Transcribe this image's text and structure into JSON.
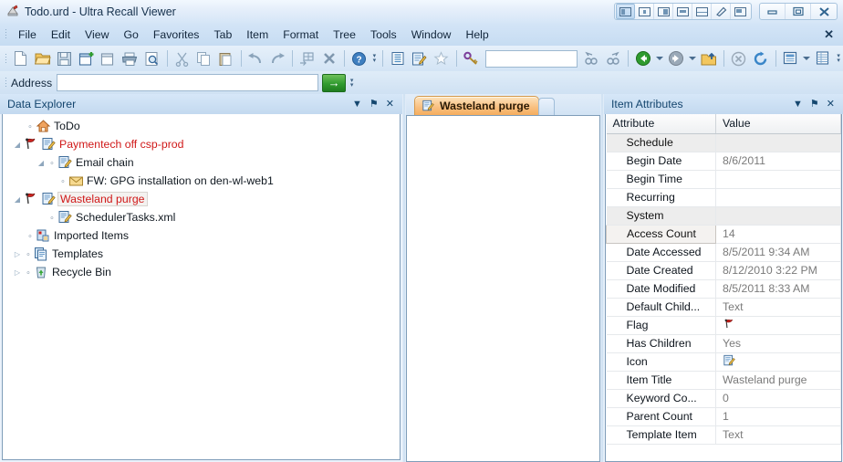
{
  "window": {
    "title": "Todo.urd - Ultra Recall Viewer",
    "icon": "app-icon",
    "layout_buttons": [
      {
        "name": "layout-left-pane",
        "icon": "panel-left-icon"
      },
      {
        "name": "layout-center-pane",
        "icon": "panel-center-icon"
      },
      {
        "name": "layout-right-pane",
        "icon": "panel-right-icon"
      },
      {
        "name": "layout-wide-pane",
        "icon": "panel-wide-icon"
      },
      {
        "name": "layout-split-horizontal",
        "icon": "panel-split-icon"
      },
      {
        "name": "layout-float",
        "icon": "panel-float-icon"
      },
      {
        "name": "layout-tabbed",
        "icon": "panel-tabbed-icon"
      }
    ],
    "controls": [
      {
        "name": "minimize-button",
        "icon": "minimize-icon",
        "glyph": "–"
      },
      {
        "name": "maximize-button",
        "icon": "maximize-icon",
        "glyph": "□"
      },
      {
        "name": "close-button",
        "icon": "close-icon",
        "glyph": "✕"
      }
    ]
  },
  "menubar": {
    "items": [
      "File",
      "Edit",
      "View",
      "Go",
      "Favorites",
      "Tab",
      "Item",
      "Format",
      "Tree",
      "Tools",
      "Window",
      "Help"
    ],
    "close_glyph": "✕"
  },
  "toolbar": {
    "buttons": [
      {
        "name": "new-document-button",
        "icon": "new-document-icon"
      },
      {
        "name": "open-button",
        "icon": "open-folder-icon"
      },
      {
        "name": "save-button",
        "icon": "save-disk-icon"
      },
      {
        "name": "new-item-button",
        "icon": "new-item-icon"
      },
      {
        "name": "new-window-button",
        "icon": "new-window-icon"
      },
      {
        "name": "print-button",
        "icon": "printer-icon"
      },
      {
        "name": "print-preview-button",
        "icon": "print-preview-icon"
      },
      {
        "name": "cut-button",
        "icon": "scissors-icon"
      },
      {
        "name": "copy-button",
        "icon": "copy-icon"
      },
      {
        "name": "paste-button",
        "icon": "paste-icon"
      },
      {
        "name": "undo-button",
        "icon": "undo-arrow-icon"
      },
      {
        "name": "redo-button",
        "icon": "redo-arrow-icon"
      },
      {
        "name": "insert-button",
        "icon": "insert-grid-icon"
      },
      {
        "name": "delete-button",
        "icon": "delete-x-icon"
      },
      {
        "name": "help-button",
        "icon": "help-question-icon"
      },
      {
        "name": "outline-button",
        "icon": "outline-list-icon"
      },
      {
        "name": "edit-item-button",
        "icon": "edit-note-icon"
      },
      {
        "name": "favorites-button",
        "icon": "star-icon"
      },
      {
        "name": "keyword-button",
        "icon": "key-icon"
      },
      {
        "name": "find-previous-button",
        "icon": "find-back-icon"
      },
      {
        "name": "find-next-button",
        "icon": "find-forward-icon"
      },
      {
        "name": "back-button",
        "icon": "back-green-arrow-icon"
      },
      {
        "name": "forward-button",
        "icon": "forward-gray-arrow-icon"
      },
      {
        "name": "up-folder-button",
        "icon": "up-folder-icon"
      },
      {
        "name": "stop-button",
        "icon": "stop-circle-icon"
      },
      {
        "name": "refresh-button",
        "icon": "refresh-icon"
      },
      {
        "name": "view-mode-button",
        "icon": "view-pane-icon"
      },
      {
        "name": "properties-button",
        "icon": "properties-grid-icon"
      }
    ],
    "search": {
      "value": "",
      "placeholder": ""
    },
    "overflow_glyph": "⌵"
  },
  "address": {
    "label": "Address",
    "value": "",
    "placeholder": "",
    "go_glyph": "→",
    "go_title": "Go"
  },
  "left_panel": {
    "title": "Data Explorer",
    "tools": [
      {
        "name": "panel-menu-button",
        "icon": "chevron-down-icon",
        "glyph": "▼"
      },
      {
        "name": "panel-pin-button",
        "icon": "pin-icon",
        "glyph": "⚑"
      },
      {
        "name": "panel-close-button",
        "icon": "close-icon",
        "glyph": "✕"
      }
    ],
    "tree": [
      {
        "label": "ToDo",
        "icon": "home-icon",
        "indent": 0,
        "expander": "",
        "dot": true,
        "style": "normal"
      },
      {
        "label": "Paymentech off csp-prod",
        "icon": "note-edit-icon",
        "indent": 0,
        "expander": "collapse",
        "dot": false,
        "flag": true,
        "style": "red"
      },
      {
        "label": "Email chain",
        "icon": "note-edit-icon",
        "indent": 1,
        "expander": "collapse",
        "dot": true,
        "style": "normal"
      },
      {
        "label": "FW: GPG installation on den-wl-web1",
        "icon": "envelope-icon",
        "indent": 2,
        "expander": "",
        "dot": true,
        "style": "normal"
      },
      {
        "label": "Wasteland purge",
        "icon": "note-edit-icon",
        "indent": 0,
        "expander": "collapse",
        "dot": false,
        "flag": true,
        "style": "selected"
      },
      {
        "label": "SchedulerTasks.xml",
        "icon": "note-edit-icon",
        "indent": 1,
        "expander": "",
        "dot": true,
        "style": "normal"
      },
      {
        "label": "Imported Items",
        "icon": "imported-items-icon",
        "indent": 0,
        "expander": "",
        "dot": true,
        "style": "normal"
      },
      {
        "label": "Templates",
        "icon": "templates-icon",
        "indent": 0,
        "expander": "expand",
        "dot": true,
        "style": "normal"
      },
      {
        "label": "Recycle Bin",
        "icon": "recycle-bin-icon",
        "indent": 0,
        "expander": "expand",
        "dot": true,
        "style": "normal"
      }
    ]
  },
  "center_panel": {
    "tab": {
      "label": "Wasteland purge",
      "icon": "note-edit-icon",
      "active": true
    },
    "content": ""
  },
  "right_panel": {
    "title": "Item Attributes",
    "tools": [
      {
        "name": "panel-menu-button",
        "icon": "chevron-down-icon",
        "glyph": "▼"
      },
      {
        "name": "panel-pin-button",
        "icon": "pin-icon",
        "glyph": "⚑"
      },
      {
        "name": "panel-close-button",
        "icon": "close-icon",
        "glyph": "✕"
      }
    ],
    "columns": [
      "Attribute",
      "Value"
    ],
    "rows": [
      {
        "name": "Schedule",
        "value": "",
        "group": true
      },
      {
        "name": "Begin Date",
        "value": "8/6/2011"
      },
      {
        "name": "Begin Time",
        "value": ""
      },
      {
        "name": "Recurring",
        "value": ""
      },
      {
        "name": "System",
        "value": "",
        "group": true
      },
      {
        "name": "Access Count",
        "value": "14",
        "selected": true
      },
      {
        "name": "Date Accessed",
        "value": "8/5/2011 9:34 AM"
      },
      {
        "name": "Date Created",
        "value": "8/12/2010 3:22 PM"
      },
      {
        "name": "Date Modified",
        "value": "8/5/2011 8:33 AM"
      },
      {
        "name": "Default Child...",
        "value": "Text"
      },
      {
        "name": "Flag",
        "value": "",
        "icon": "red-flag-icon"
      },
      {
        "name": "Has Children",
        "value": "Yes"
      },
      {
        "name": "Icon",
        "value": "",
        "icon": "note-edit-icon"
      },
      {
        "name": "Item Title",
        "value": "Wasteland purge"
      },
      {
        "name": "Keyword Co...",
        "value": "0"
      },
      {
        "name": "Parent Count",
        "value": "1"
      },
      {
        "name": "Template Item",
        "value": "Text"
      }
    ]
  },
  "colors": {
    "accent_blue": "#c6dcf2",
    "tab_orange": "#f5ad5e",
    "alert_red": "#d01818",
    "go_green": "#2f9b2f",
    "panel_title": "#14456e",
    "value_gray": "#7a7a7a"
  }
}
